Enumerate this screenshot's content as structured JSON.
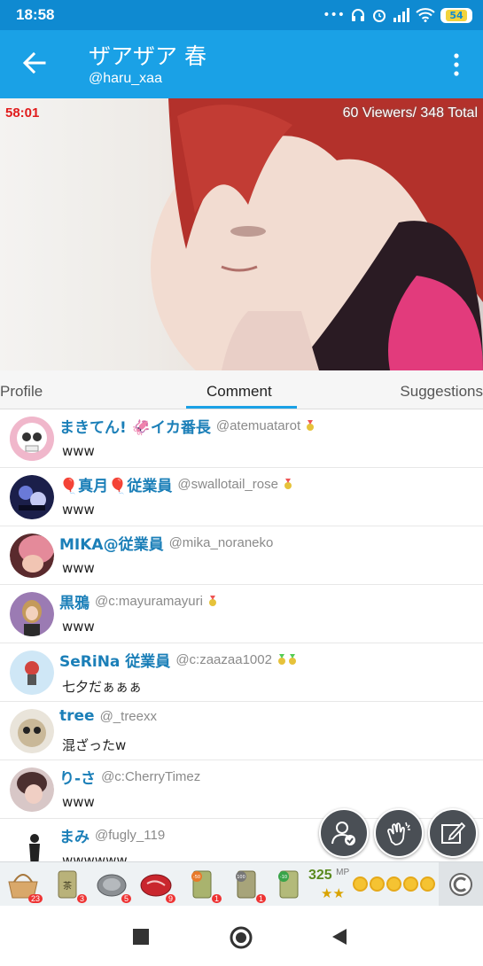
{
  "status_bar": {
    "time": "18:58",
    "battery": "54"
  },
  "header": {
    "title": "ザアザア 春",
    "handle": "@haru_xaa"
  },
  "video": {
    "elapsed": "58:01",
    "viewers": "60 Viewers/ 348 Total"
  },
  "tabs": [
    {
      "label": "Profile"
    },
    {
      "label": "Comment"
    },
    {
      "label": "Suggestions"
    }
  ],
  "comments": [
    {
      "name": "まきてん! 🦑イカ番長",
      "handle": "@atemuatarot",
      "text": "www"
    },
    {
      "name": "🎈真月🎈従業員",
      "handle": "@swallotail_rose",
      "text": "www"
    },
    {
      "name": "MIKA@従業員",
      "handle": "@mika_noraneko",
      "text": "www"
    },
    {
      "name": "黒鴉",
      "handle": "@c:mayuramayuri",
      "text": "www"
    },
    {
      "name": "SeRiNa 従業員",
      "handle": "@c:zaazaa1002",
      "text": "七夕だぁぁぁ"
    },
    {
      "name": "tree",
      "handle": "@_treexx",
      "text": "混ざったw"
    },
    {
      "name": "り-さ",
      "handle": "@c:CherryTimez",
      "text": "www"
    },
    {
      "name": "まみ",
      "handle": "@fugly_119",
      "text": "wwwwww"
    }
  ],
  "gifts": [
    {
      "count": "23"
    },
    {
      "count": "3"
    },
    {
      "count": "5"
    },
    {
      "count": "9"
    },
    {
      "count": "1"
    },
    {
      "count": "1"
    },
    {
      "count": ""
    }
  ],
  "gift_labels": {
    "g1": "茶",
    "g5": "-50",
    "g6": "100",
    "g7": "-10"
  },
  "points": {
    "value": "325",
    "unit": "MP",
    "stars": "★★"
  },
  "colors": {
    "appbar": "#1aa1e6",
    "statusbar": "#0f8ad1",
    "name": "#1b7fb8",
    "timer": "#e11c1c"
  }
}
